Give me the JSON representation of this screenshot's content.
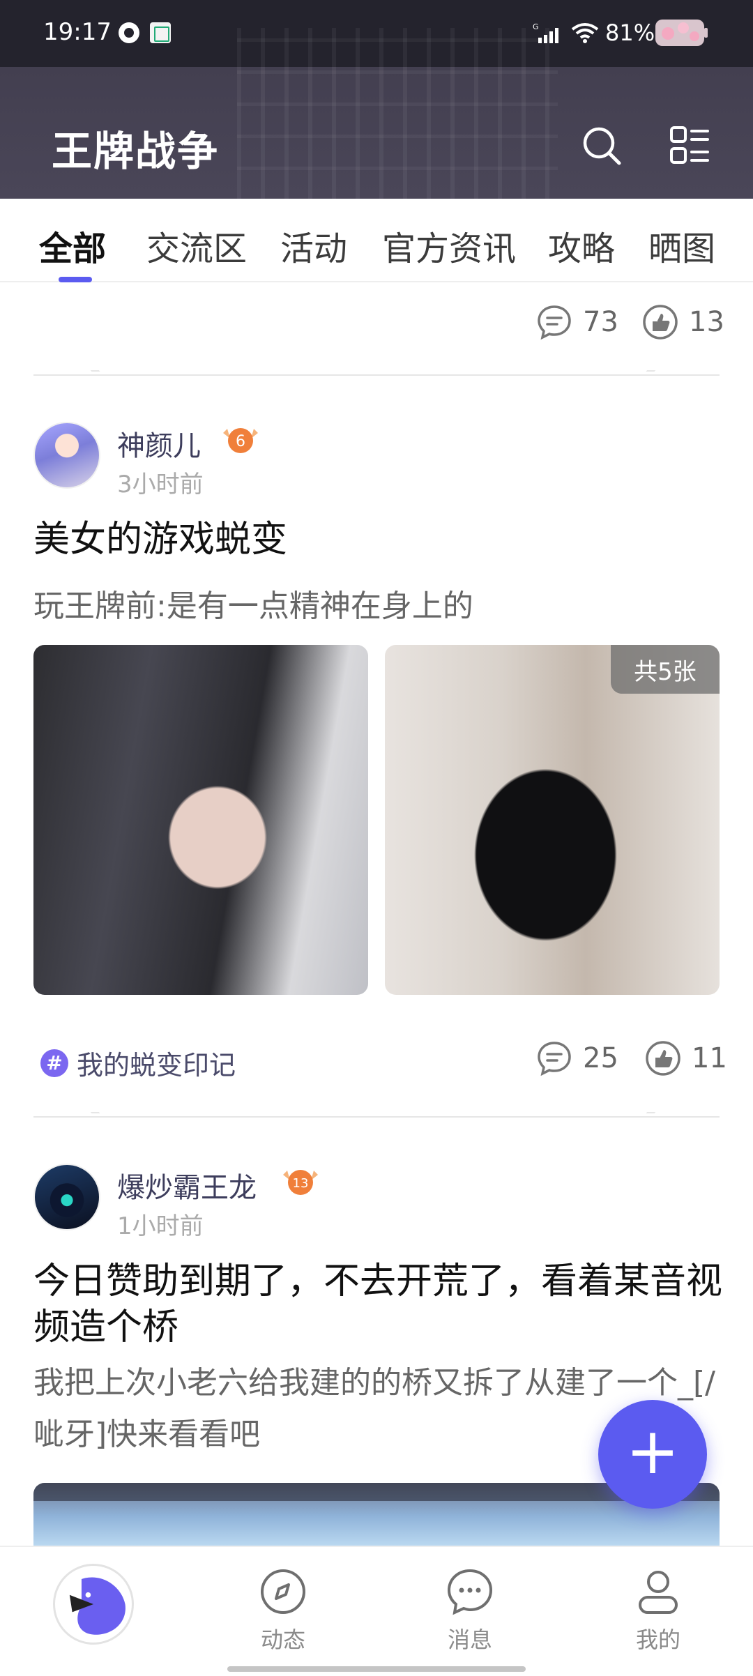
{
  "status_bar": {
    "time": "19:17",
    "battery": "81%"
  },
  "header": {
    "title": "王牌战争"
  },
  "tabs": [
    {
      "label": "全部",
      "active": true
    },
    {
      "label": "交流区"
    },
    {
      "label": "活动"
    },
    {
      "label": "官方资讯"
    },
    {
      "label": "攻略"
    },
    {
      "label": "晒图"
    }
  ],
  "feed": {
    "top_stats": {
      "comments": "73",
      "likes": "13"
    },
    "posts": [
      {
        "username": "神颜儿",
        "level": "6",
        "time": "3小时前",
        "title": "美女的游戏蜕变",
        "body": "玩王牌前:是有一点精神在身上的",
        "photo_count": "共5张",
        "topic": "我的蜕变印记",
        "comments": "25",
        "likes": "11"
      },
      {
        "username": "爆炒霸王龙",
        "level": "13",
        "time": "1小时前",
        "title": "今日赞助到期了，不去开荒了，看着某音视频造个桥",
        "body": "我把上次小老六给我建的的桥又拆了从建了一个_[/呲牙]快来看看吧"
      }
    ]
  },
  "bottom_nav": [
    {
      "label": "动态",
      "icon": "compass-icon"
    },
    {
      "label": "消息",
      "icon": "chat-bubble-icon"
    },
    {
      "label": "我的",
      "icon": "person-icon"
    }
  ],
  "colors": {
    "accent": "#5b5bf0",
    "header_bg": "#4a4658",
    "level_badge": "#f07f3a"
  }
}
